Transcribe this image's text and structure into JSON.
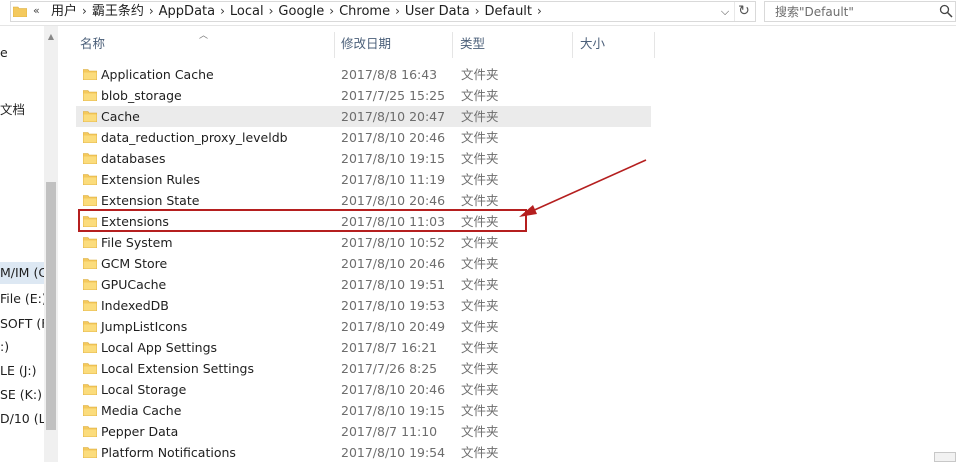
{
  "address": {
    "overflow_chevron": "«",
    "crumbs": [
      "用户",
      "霸王条约",
      "AppData",
      "Local",
      "Google",
      "Chrome",
      "User Data",
      "Default"
    ],
    "separator": "›",
    "dropdown": "⌵",
    "refresh": "↻"
  },
  "search": {
    "placeholder": "搜索\"Default\""
  },
  "nav": {
    "items": [
      "e",
      "文档",
      "M/IM (C:",
      "File (E:)",
      "SOFT (F",
      ":)",
      "LE (J:)",
      "SE (K:)",
      "D/10 (L"
    ]
  },
  "columns": {
    "name": "名称",
    "date": "修改日期",
    "type": "类型",
    "size": "大小"
  },
  "rows": [
    {
      "name": "Application Cache",
      "date": "2017/8/8 16:43",
      "type": "文件夹"
    },
    {
      "name": "blob_storage",
      "date": "2017/7/25 15:25",
      "type": "文件夹"
    },
    {
      "name": "Cache",
      "date": "2017/8/10 20:47",
      "type": "文件夹"
    },
    {
      "name": "data_reduction_proxy_leveldb",
      "date": "2017/8/10 20:46",
      "type": "文件夹"
    },
    {
      "name": "databases",
      "date": "2017/8/10 19:15",
      "type": "文件夹"
    },
    {
      "name": "Extension Rules",
      "date": "2017/8/10 11:19",
      "type": "文件夹"
    },
    {
      "name": "Extension State",
      "date": "2017/8/10 20:46",
      "type": "文件夹"
    },
    {
      "name": "Extensions",
      "date": "2017/8/10 11:03",
      "type": "文件夹"
    },
    {
      "name": "File System",
      "date": "2017/8/10 10:52",
      "type": "文件夹"
    },
    {
      "name": "GCM Store",
      "date": "2017/8/10 20:46",
      "type": "文件夹"
    },
    {
      "name": "GPUCache",
      "date": "2017/8/10 19:51",
      "type": "文件夹"
    },
    {
      "name": "IndexedDB",
      "date": "2017/8/10 19:53",
      "type": "文件夹"
    },
    {
      "name": "JumpListIcons",
      "date": "2017/8/10 20:49",
      "type": "文件夹"
    },
    {
      "name": "Local App Settings",
      "date": "2017/8/7 16:21",
      "type": "文件夹"
    },
    {
      "name": "Local Extension Settings",
      "date": "2017/7/26 8:25",
      "type": "文件夹"
    },
    {
      "name": "Local Storage",
      "date": "2017/8/10 20:46",
      "type": "文件夹"
    },
    {
      "name": "Media Cache",
      "date": "2017/8/10 19:15",
      "type": "文件夹"
    },
    {
      "name": "Pepper Data",
      "date": "2017/8/7 11:10",
      "type": "文件夹"
    },
    {
      "name": "Platform Notifications",
      "date": "2017/8/10 19:54",
      "type": "文件夹"
    }
  ],
  "colors": {
    "highlight": "#b51f1f",
    "folder": "#f4c95d",
    "hover_row": "#ebebeb"
  },
  "icons": {
    "folder": "folder-icon",
    "search": "search-icon",
    "refresh": "refresh-icon"
  }
}
